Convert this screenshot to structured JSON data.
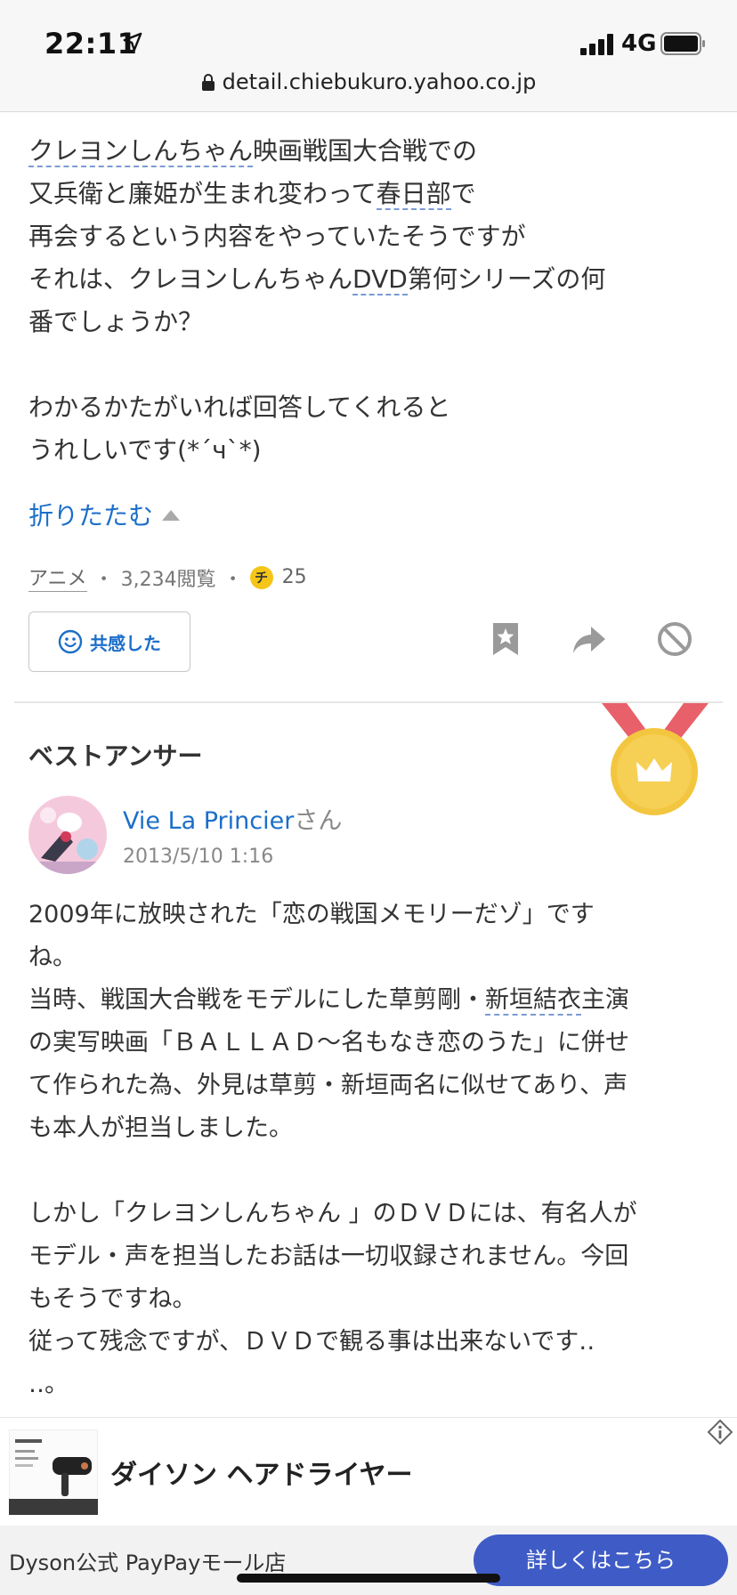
{
  "status": {
    "time": "22:11",
    "network": "4G"
  },
  "browser": {
    "url": "detail.chiebukuro.yahoo.co.jp"
  },
  "question": {
    "lines": [
      [
        "",
        "クレヨンしんちゃん",
        "映画戦国大合戦での"
      ],
      [
        "又兵衛と廉姫が生まれ変わって",
        "春日部",
        "で"
      ],
      [
        "再会するという内容をやっていたそうですが",
        "",
        ""
      ],
      [
        "それは、クレヨンしんちゃん",
        "DVD",
        "第何シリーズの何"
      ],
      [
        "番でしょうか？",
        "",
        ""
      ],
      [
        "",
        "",
        ""
      ],
      [
        "わかるかたがいれば回答してくれると",
        "",
        ""
      ],
      [
        "うれしいです(*´ч`*)",
        "",
        ""
      ]
    ],
    "fold_label": "折りたたむ",
    "category": "アニメ",
    "views": "3,234閲覧",
    "coin_symbol": "チ",
    "coins": "25",
    "empathy_label": "共感した"
  },
  "best_answer": {
    "title": "ベストアンサー",
    "user": "Vie La Princier",
    "honorific": "さん",
    "date": "2013/5/10 1:16",
    "lines": [
      [
        "2009年に放映された「恋の戦国メモリーだゾ」です",
        "",
        ""
      ],
      [
        "ね。",
        "",
        ""
      ],
      [
        "当時、戦国大合戦をモデルにした草剪剛・",
        "新垣結衣",
        "主演"
      ],
      [
        "の実写映画「ＢＡＬＬＡＤ～名もなき恋のうた」に併せ",
        "",
        ""
      ],
      [
        "て作られた為、外見は草剪・新垣両名に似せてあり、声",
        "",
        ""
      ],
      [
        "も本人が担当しました。",
        "",
        ""
      ],
      [
        "",
        "",
        ""
      ],
      [
        "しかし「クレヨンしんちゃん 」のＤＶＤには、有名人が",
        "",
        ""
      ],
      [
        "モデル・声を担当したお話は一切収録されません。今回",
        "",
        ""
      ],
      [
        "もそうですね。",
        "",
        ""
      ],
      [
        "従って残念ですが、ＤＶＤで観る事は出来ないです‥",
        "",
        ""
      ],
      [
        "‥。",
        "",
        ""
      ]
    ]
  },
  "ad": {
    "title": "ダイソン ヘアドライヤー",
    "shop": "Dyson公式 PayPayモール店",
    "cta": "詳しくはこちら"
  },
  "colors": {
    "link": "#1c6ec9",
    "cta": "#3f5cc6",
    "coin": "#f5c518",
    "medal": "#f3c63f",
    "ribbon": "#e8606a"
  }
}
